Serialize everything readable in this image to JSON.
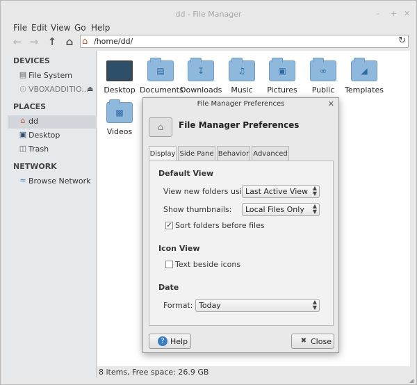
{
  "window": {
    "title": "dd - File Manager",
    "controls": [
      "–",
      "+",
      "✕"
    ]
  },
  "menu": [
    "File",
    "Edit",
    "View",
    "Go",
    "Help"
  ],
  "toolbar": {
    "back_icon": "back-arrow-icon",
    "forward_icon": "forward-arrow-icon",
    "up_icon": "up-arrow-icon",
    "home_icon": "home-icon"
  },
  "location": {
    "path": "/home/dd/"
  },
  "sidebar": {
    "devices_title": "DEVICES",
    "devices": [
      {
        "label": "File System",
        "icon": "hard-drive-icon"
      },
      {
        "label": "VBOXADDITIO...",
        "icon": "disc-icon"
      }
    ],
    "places_title": "PLACES",
    "places": [
      {
        "label": "dd",
        "icon": "home-icon"
      },
      {
        "label": "Desktop",
        "icon": "desktop-icon"
      },
      {
        "label": "Trash",
        "icon": "trash-icon"
      }
    ],
    "network_title": "NETWORK",
    "network": [
      {
        "label": "Browse Network",
        "icon": "network-icon"
      }
    ]
  },
  "files": [
    {
      "name": "Desktop",
      "icon": "desktop-icon"
    },
    {
      "name": "Documents",
      "icon": "document-folder-icon"
    },
    {
      "name": "Downloads",
      "icon": "download-folder-icon"
    },
    {
      "name": "Music",
      "icon": "music-folder-icon"
    },
    {
      "name": "Pictures",
      "icon": "pictures-folder-icon"
    },
    {
      "name": "Public",
      "icon": "public-folder-icon"
    },
    {
      "name": "Templates",
      "icon": "templates-folder-icon"
    },
    {
      "name": "Videos",
      "icon": "videos-folder-icon"
    }
  ],
  "status": {
    "text": "8 items, Free space: 26.9 GB"
  },
  "dialog": {
    "title": "File Manager Preferences",
    "header": "File Manager Preferences",
    "tabs": [
      "Display",
      "Side Pane",
      "Behavior",
      "Advanced"
    ],
    "active_tab": "Display",
    "default_view": {
      "title": "Default View",
      "view_new_label": "View new folders using:",
      "view_new_value": "Last Active View",
      "thumbnails_label": "Show thumbnails:",
      "thumbnails_value": "Local Files Only",
      "sort_label": "Sort folders before files",
      "sort_checked": true
    },
    "icon_view": {
      "title": "Icon View",
      "text_beside_label": "Text beside icons",
      "text_beside_checked": false
    },
    "date": {
      "title": "Date",
      "format_label": "Format:",
      "format_value": "Today"
    },
    "help_label": "Help",
    "close_label": "Close"
  },
  "colors": {
    "accent": "#3a7ec2",
    "folder": "#8fb8dd",
    "sidebar_selected": "#d3d7dc"
  }
}
